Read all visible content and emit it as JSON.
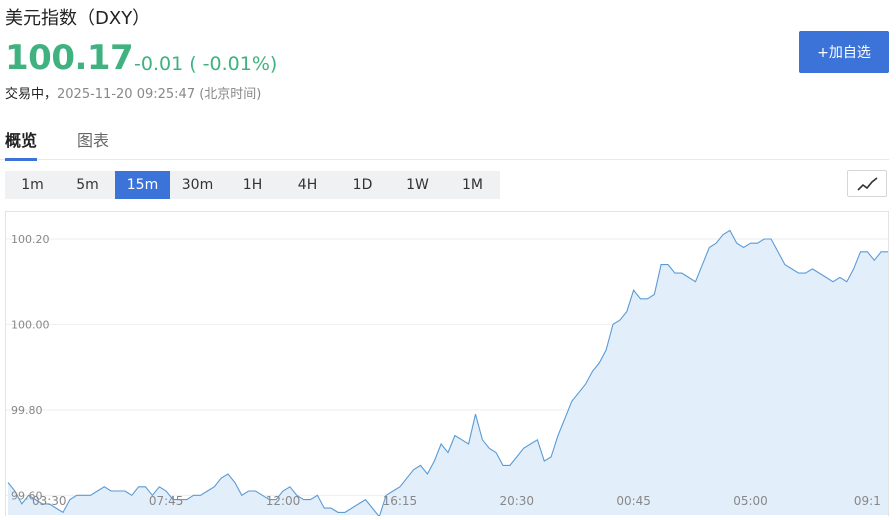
{
  "header": {
    "title": "美元指数（DXY）",
    "price": "100.17",
    "change": "-0.01 ( -0.01%)",
    "status": "交易中，",
    "timestamp": "2025-11-20 09:25:47 (北京时间)",
    "add_button": "+加自选"
  },
  "tabs": [
    {
      "label": "概览",
      "active": true
    },
    {
      "label": "图表",
      "active": false
    }
  ],
  "periods": [
    {
      "label": "1m",
      "active": false
    },
    {
      "label": "5m",
      "active": false
    },
    {
      "label": "15m",
      "active": true
    },
    {
      "label": "30m",
      "active": false
    },
    {
      "label": "1H",
      "active": false
    },
    {
      "label": "4H",
      "active": false
    },
    {
      "label": "1D",
      "active": false
    },
    {
      "label": "1W",
      "active": false
    },
    {
      "label": "1M",
      "active": false
    }
  ],
  "chart_type_icon": "line-chart-icon",
  "colors": {
    "up_green": "#3fb27f",
    "accent_blue": "#3b73d9",
    "line": "#5b9bd5",
    "area": "#e3eefb"
  },
  "chart_data": {
    "type": "area",
    "title": "",
    "xlabel": "",
    "ylabel": "",
    "ylim": [
      99.575,
      100.235
    ],
    "yticks": [
      "99.60",
      "99.80",
      "100.00",
      "100.20"
    ],
    "ytick_values": [
      99.6,
      99.8,
      100.0,
      100.2
    ],
    "xticks": [
      "03:30",
      "07:45",
      "12:00",
      "16:15",
      "20:30",
      "00:45",
      "05:00",
      "09:1"
    ],
    "xtick_indices": [
      6,
      23,
      40,
      57,
      74,
      91,
      108,
      125
    ],
    "grid": true,
    "series": [
      {
        "values": [
          99.63,
          99.61,
          99.58,
          99.6,
          99.59,
          99.58,
          99.58,
          99.57,
          99.56,
          99.59,
          99.6,
          99.6,
          99.6,
          99.61,
          99.62,
          99.61,
          99.61,
          99.61,
          99.6,
          99.62,
          99.62,
          99.6,
          99.62,
          99.61,
          99.59,
          99.59,
          99.59,
          99.6,
          99.6,
          99.61,
          99.62,
          99.64,
          99.65,
          99.63,
          99.6,
          99.61,
          99.61,
          99.6,
          99.59,
          99.59,
          99.61,
          99.62,
          99.6,
          99.59,
          99.59,
          99.6,
          99.57,
          99.57,
          99.56,
          99.56,
          99.57,
          99.58,
          99.59,
          99.57,
          99.55,
          99.6,
          99.61,
          99.62,
          99.64,
          99.66,
          99.67,
          99.65,
          99.68,
          99.72,
          99.7,
          99.74,
          99.73,
          99.72,
          99.79,
          99.73,
          99.71,
          99.7,
          99.67,
          99.67,
          99.69,
          99.71,
          99.72,
          99.73,
          99.68,
          99.69,
          99.74,
          99.78,
          99.82,
          99.84,
          99.86,
          99.89,
          99.91,
          99.94,
          100.0,
          100.01,
          100.03,
          100.08,
          100.06,
          100.06,
          100.07,
          100.14,
          100.14,
          100.12,
          100.12,
          100.11,
          100.1,
          100.14,
          100.18,
          100.19,
          100.21,
          100.22,
          100.19,
          100.18,
          100.19,
          100.19,
          100.2,
          100.2,
          100.17,
          100.14,
          100.13,
          100.12,
          100.12,
          100.13,
          100.12,
          100.11,
          100.1,
          100.11,
          100.1,
          100.13,
          100.17,
          100.17,
          100.15,
          100.17,
          100.17
        ]
      }
    ]
  }
}
